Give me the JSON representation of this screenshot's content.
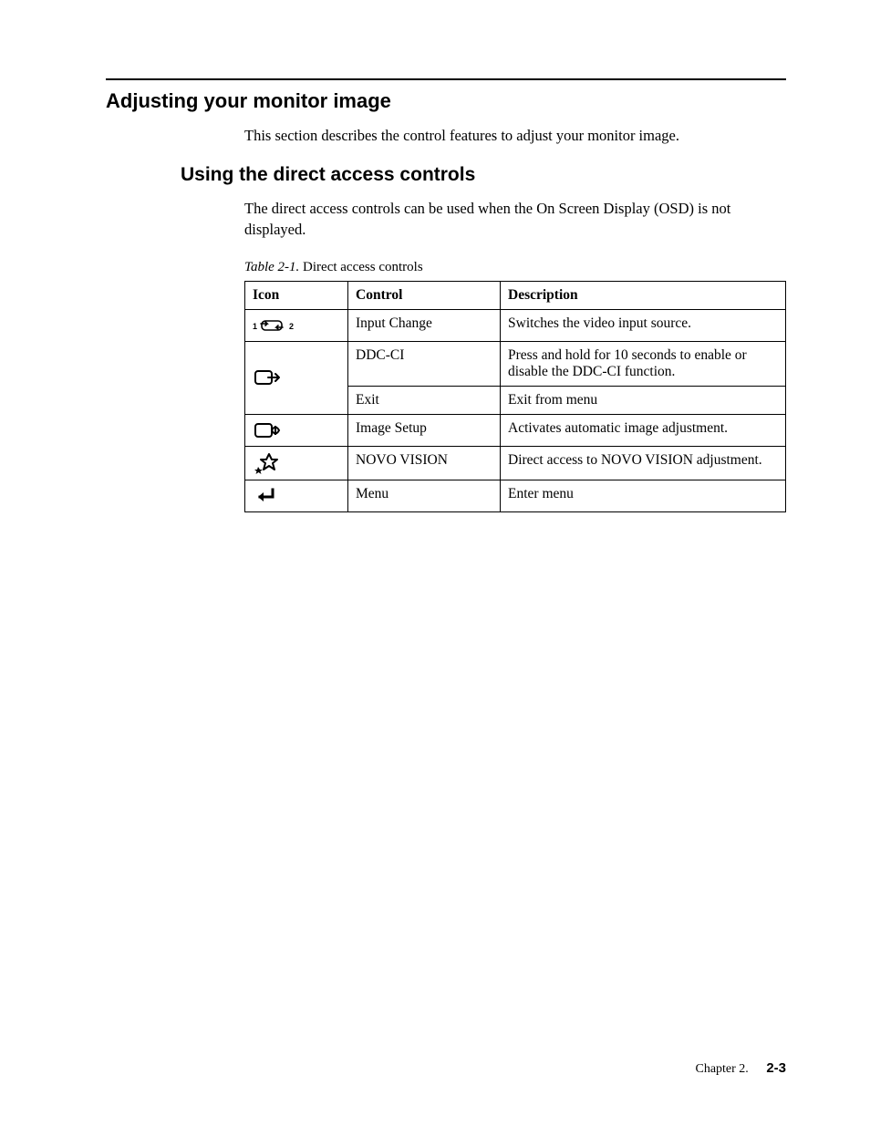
{
  "section_heading": "Adjusting your monitor image",
  "section_intro": "This section describes the control features to adjust your monitor image.",
  "subsection_heading": "Using the direct access controls",
  "subsection_body": "The direct access controls can be used when the On Screen Display (OSD) is not displayed.",
  "table_caption_label": "Table 2-1.",
  "table_caption_text": "Direct access controls",
  "table_headers": {
    "icon": "Icon",
    "control": "Control",
    "description": "Description"
  },
  "rows": [
    {
      "icon_name": "input-change-icon",
      "control": "Input Change",
      "description": "Switches the video input source."
    },
    {
      "icon_name": "exit-arrow-icon",
      "control": "DDC-CI",
      "description": "Press and hold for 10 seconds to enable or disable the DDC-CI function."
    },
    {
      "icon_name": "",
      "control": "Exit",
      "description": "Exit from menu"
    },
    {
      "icon_name": "image-setup-icon",
      "control": "Image Setup",
      "description": "Activates automatic image adjustment."
    },
    {
      "icon_name": "novo-vision-icon",
      "control": "NOVO VISION",
      "description": "Direct access to NOVO VISION adjustment."
    },
    {
      "icon_name": "enter-icon",
      "control": "Menu",
      "description": "Enter menu"
    }
  ],
  "footer_chapter": "Chapter 2.",
  "footer_page": "2-3"
}
